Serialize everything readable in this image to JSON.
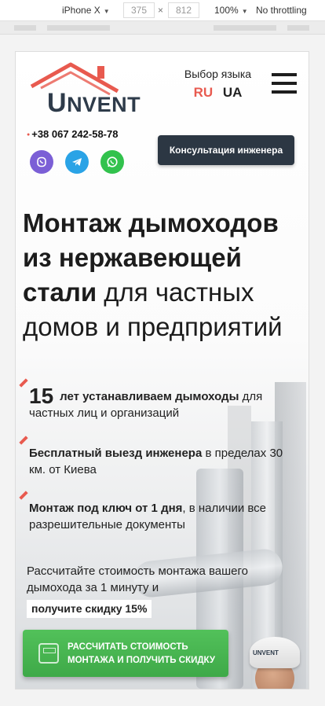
{
  "devtools": {
    "device": "iPhone X",
    "width": "375",
    "times": "×",
    "height": "812",
    "zoom": "100%",
    "throttle": "No throttling"
  },
  "header": {
    "logo_text_first": "U",
    "logo_text_rest": "NVENT",
    "lang_label": "Выбор языка",
    "lang_ru": "RU",
    "lang_ua": "UA",
    "phone": "+38 067 242-58-78",
    "consult_button": "Консультация инженера"
  },
  "hero": {
    "title_bold": "Монтаж дымоходов из нержавеющей стали",
    "title_rest": "для частных домов и предприятий"
  },
  "features": {
    "f1_num": "15",
    "f1_bold": "лет устанавливаем дымоходы",
    "f1_rest": "для частных лиц и организаций",
    "f2_bold": "Бесплатный выезд инженера",
    "f2_rest": "в пределах 30 км. от Киева",
    "f3_bold": "Монтаж под ключ от 1 дня",
    "f3_rest": ", в наличии все разрешительные документы"
  },
  "calc": {
    "text": "Рассчитайте стоимость монтажа вашего дымохода за 1 минуту и",
    "promo": "получите скидку 15%",
    "cta_line1": "РАССЧИТАТЬ СТОИМОСТЬ",
    "cta_line2": "МОНТАЖА И ПОЛУЧИТЬ СКИДКУ",
    "cap_logo": "UNVENT"
  },
  "colors": {
    "accent": "#e85a4f",
    "dark": "#2c3743",
    "cta_green": "#46b04f"
  }
}
